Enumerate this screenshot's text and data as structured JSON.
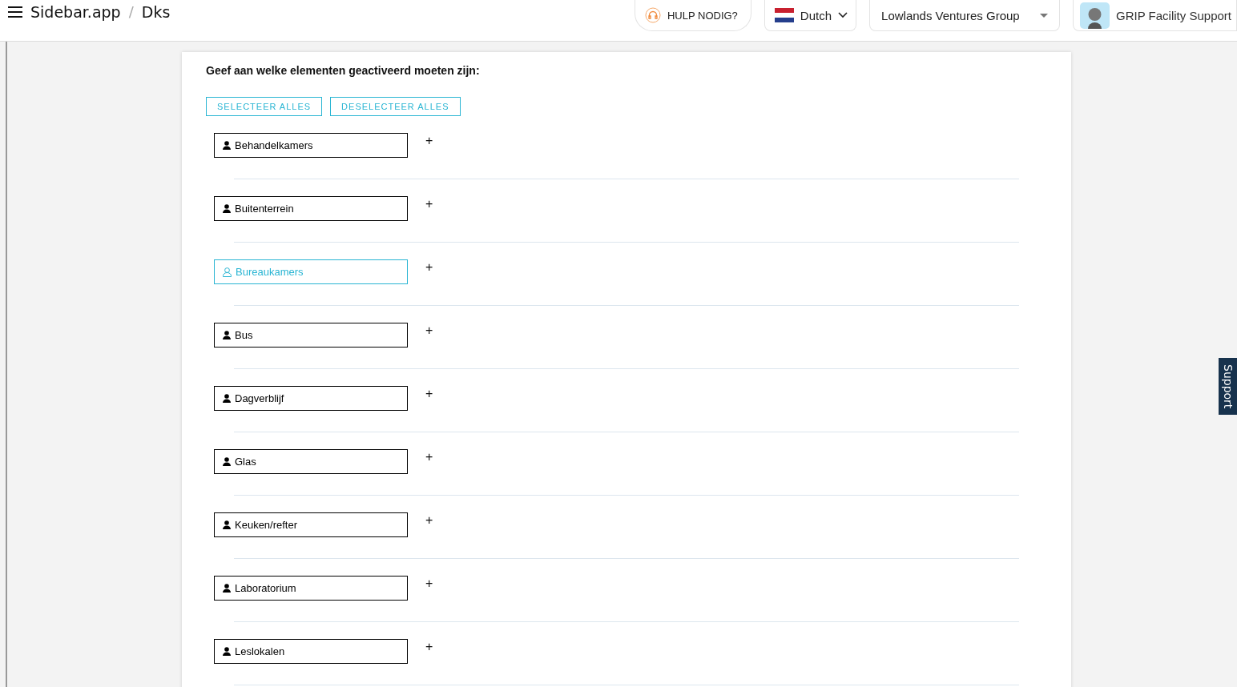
{
  "header": {
    "app_name": "Sidebar.app",
    "separator": "/",
    "page": "Dks",
    "help_button": "HULP NODIG?",
    "language": "Dutch",
    "organization": "Lowlands Ventures Group",
    "user": "GRIP Facility Support"
  },
  "card": {
    "heading": "Geef aan welke elementen geactiveerd moeten zijn:",
    "buttons": [
      "SELECTEER ALLES",
      "DESELECTEER ALLES"
    ],
    "elements": [
      {
        "label": "Behandelkamers",
        "active": true,
        "add": "+"
      },
      {
        "label": "Buitenterrein",
        "active": true,
        "add": "+"
      },
      {
        "label": "Bureaukamers",
        "active": false,
        "add": "+"
      },
      {
        "label": "Bus",
        "active": true,
        "add": "+"
      },
      {
        "label": "Dagverblijf",
        "active": true,
        "add": "+"
      },
      {
        "label": "Glas",
        "active": true,
        "add": "+"
      },
      {
        "label": "Keuken/refter",
        "active": true,
        "add": "+"
      },
      {
        "label": "Laboratorium",
        "active": true,
        "add": "+"
      },
      {
        "label": "Leslokalen",
        "active": true,
        "add": "+"
      }
    ]
  },
  "support_tab": "Support"
}
